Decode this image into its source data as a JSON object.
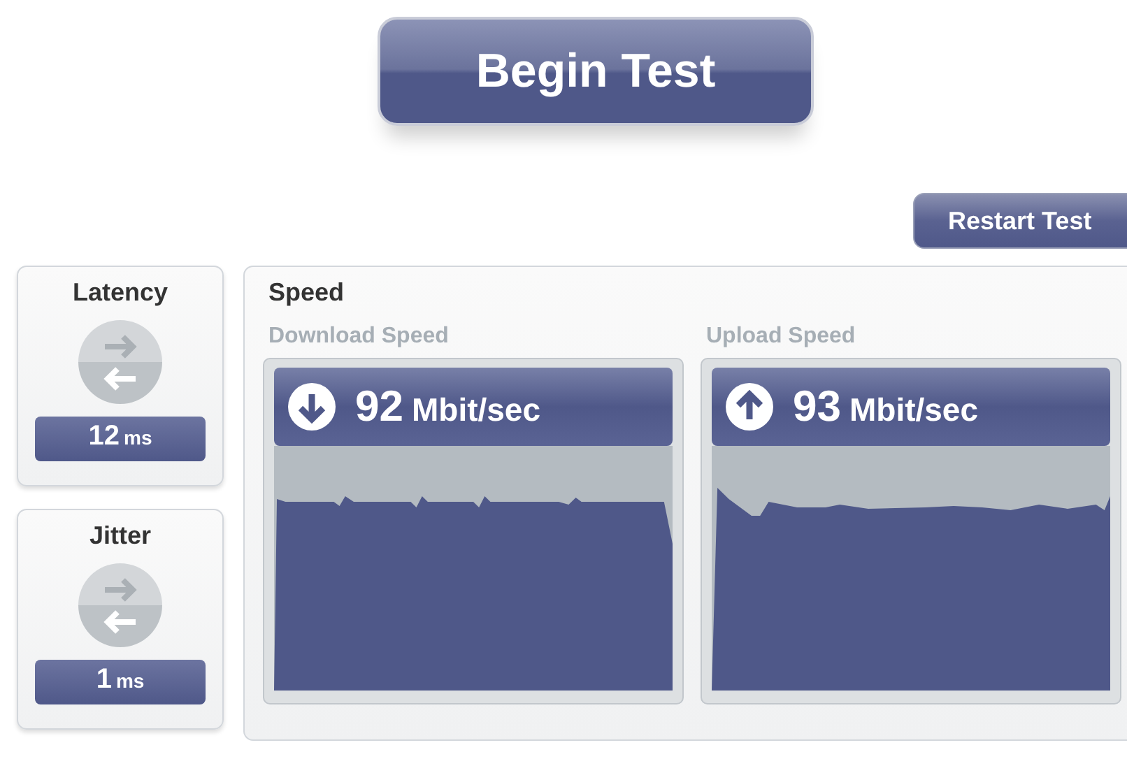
{
  "begin_button": {
    "label": "Begin Test"
  },
  "restart_button": {
    "label": "Restart Test"
  },
  "metrics": [
    {
      "label": "Latency",
      "value": "12",
      "unit": "ms"
    },
    {
      "label": "Jitter",
      "value": "1",
      "unit": "ms"
    }
  ],
  "speed_panel": {
    "title": "Speed",
    "gauges": [
      {
        "kind": "download",
        "label": "Download Speed",
        "value": "92",
        "unit": "Mbit/sec"
      },
      {
        "kind": "upload",
        "label": "Upload Speed",
        "value": "93",
        "unit": "Mbit/sec"
      }
    ]
  }
}
